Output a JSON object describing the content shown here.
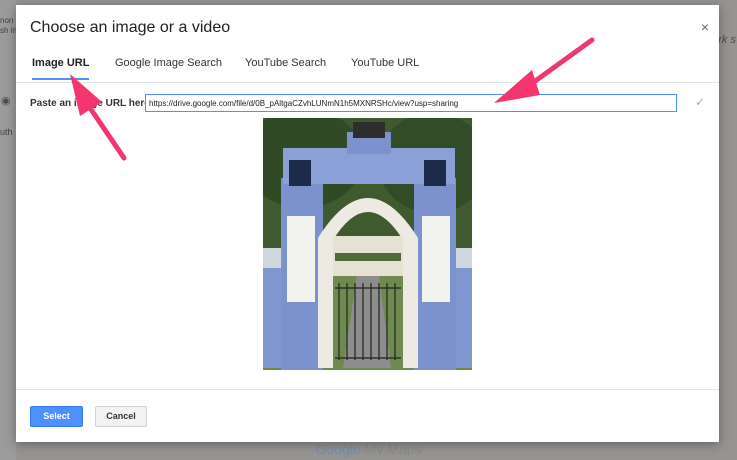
{
  "background": {
    "left_text_1": "non",
    "left_text_2": "sh in",
    "left_text_3": "uth",
    "right_text": "rk s",
    "map_logo_google": "Google",
    "map_logo_suffix": " My Maps"
  },
  "dialog": {
    "title": "Choose an image or a video",
    "close_symbol": "×",
    "tabs": [
      {
        "label": "Image URL",
        "active": true
      },
      {
        "label": "Google Image Search",
        "active": false
      },
      {
        "label": "YouTube Search",
        "active": false
      },
      {
        "label": "YouTube URL",
        "active": false
      }
    ],
    "url_label": "Paste an image URL here:",
    "url_value": "https://drive.google.com/file/d/0B_pAltgaCZvhLUNmN1h5MXNRSHc/view?usp=sharing",
    "check_symbol": "✓",
    "select_label": "Select",
    "cancel_label": "Cancel"
  },
  "colors": {
    "accent": "#4d90fe",
    "arrow": "#f2366e"
  },
  "icons": {
    "close": "close-icon",
    "check": "check-icon",
    "visibility": "eye-icon"
  }
}
